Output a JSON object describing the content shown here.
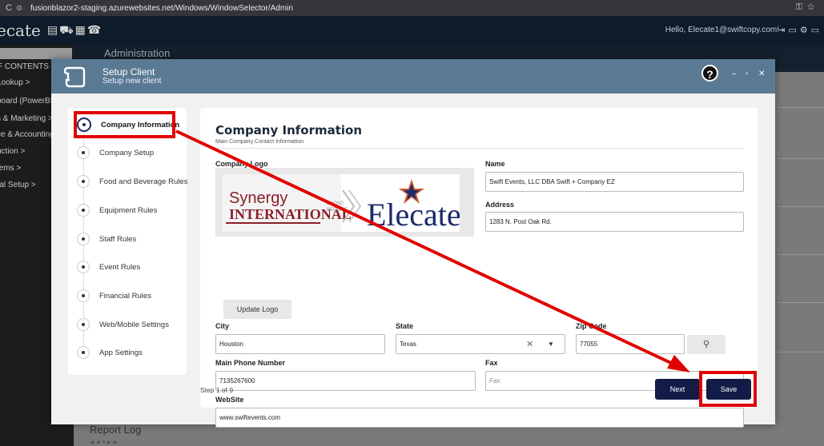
{
  "browser": {
    "url": "fusionblazor2-staging.azurewebsites.net/Windows/WindowSelector/Admin",
    "reload_icon": "reload-icon",
    "site_icon": "site-info-icon"
  },
  "header": {
    "brand": "ecate",
    "greeting": "Hello, Elecate1@swiftcopy.com!"
  },
  "sidebar": {
    "toc": "F CONTENTS",
    "items": [
      {
        "label": "Lookup  >"
      },
      {
        "label": "board (PowerBI)"
      },
      {
        "label": "s & Marketing  >"
      },
      {
        "label": "ce & Accounting"
      },
      {
        "label": "uction  >"
      },
      {
        "label": "tems  >"
      },
      {
        "label": "ral Setup  >"
      }
    ]
  },
  "background": {
    "admin_title": "Administration",
    "report_log": "Report Log"
  },
  "modal": {
    "title": "Setup Client",
    "subtitle": "Setup new client",
    "help": "?",
    "minimize": "–",
    "maximize": "▫",
    "close": "✕"
  },
  "steps": [
    {
      "label": "Company Information",
      "active": true
    },
    {
      "label": "Company Setup"
    },
    {
      "label": "Food and Beverage Rules"
    },
    {
      "label": "Equipment Rules"
    },
    {
      "label": "Staff Rules"
    },
    {
      "label": "Event Rules"
    },
    {
      "label": "Financial Rules"
    },
    {
      "label": "Web/Mobile Settings"
    },
    {
      "label": "App Settings"
    }
  ],
  "form": {
    "title": "Company Information",
    "subtitle": "Main Company Contact Information",
    "logo_label": "Company Logo",
    "logo": {
      "left_line1": "Synergy",
      "left_line2": "INTERNATIONAL",
      "middle": "EYOND\nBECOME",
      "right": "Elecate"
    },
    "update_logo": "Update Logo",
    "name_label": "Name",
    "name_value": "Swift Events, LLC DBA Swift + Company EZ",
    "address_label": "Address",
    "address_value": "1283 N. Post Oak Rd.",
    "city_label": "City",
    "city_value": "Houston",
    "state_label": "State",
    "state_value": "Texas",
    "zip_label": "Zip Code",
    "zip_value": "77055",
    "phone_label": "Main Phone Number",
    "phone_value": "7135267600",
    "fax_label": "Fax",
    "fax_placeholder": "Fax",
    "website_label": "WebSite",
    "website_value": "www.swiftevents.com",
    "step_count": "Step 1 of 9",
    "next": "Next",
    "save": "Save"
  },
  "colors": {
    "modal_header": "#5a7a93",
    "primary_button": "#121c46",
    "highlight": "#e00000"
  }
}
